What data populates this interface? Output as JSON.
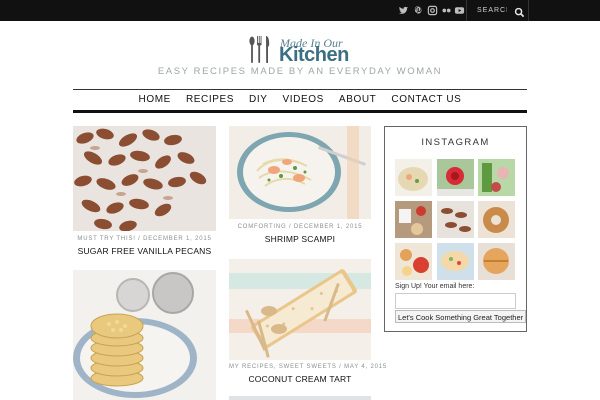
{
  "topbar": {
    "social_icons": [
      "twitter-icon",
      "pinterest-icon",
      "instagram-icon",
      "flickr-icon",
      "youtube-icon"
    ],
    "search_placeholder": "SEARCH"
  },
  "brand": {
    "logo_small": "Made In Our",
    "logo_main": "Kitchen",
    "tagline": "EASY RECIPES MADE BY AN EVERYDAY WOMAN",
    "accent_color": "#3c6f84"
  },
  "nav": {
    "items": [
      "HOME",
      "RECIPES",
      "DIY",
      "VIDEOS",
      "ABOUT",
      "CONTACT US"
    ]
  },
  "posts": [
    {
      "meta": "MUST TRY THIS! / DECEMBER 1, 2015",
      "title": "SUGAR FREE VANILLA PECANS"
    },
    {
      "meta": "COMFORTING / DECEMBER 1, 2015",
      "title": "SHRIMP SCAMPI"
    },
    {
      "meta": "MY RECIPES, SWEET SWEETS / MAY 4, 2015",
      "title": "COCONUT CREAM TART"
    }
  ],
  "sidebar": {
    "instagram_title": "INSTAGRAM",
    "signup_label": "Sign Up! Your email here:",
    "email_value": "",
    "cta_label": "Let's Cook Something Great Together"
  }
}
